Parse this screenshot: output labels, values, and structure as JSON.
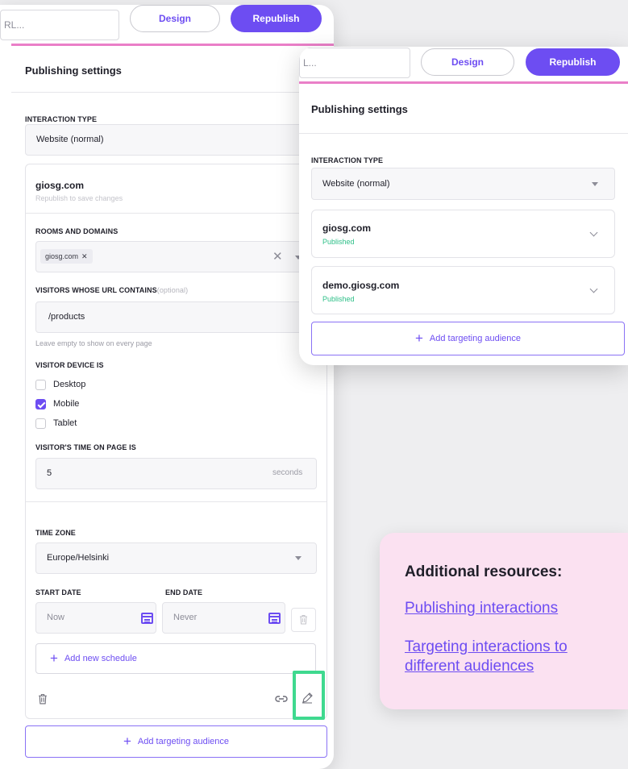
{
  "top_strip": {
    "url_placeholder": "RL...",
    "url_placeholder_right": "L..."
  },
  "toolbar": {
    "design_label": "Design",
    "republish_label": "Republish"
  },
  "left_panel": {
    "title": "Publishing settings",
    "interaction_type_label": "INTERACTION TYPE",
    "interaction_type_value": "Website (normal)",
    "domain": {
      "name": "giosg.com",
      "note": "Republish to save changes"
    },
    "rooms_label": "ROOMS AND DOMAINS",
    "room_chip": "giosg.com",
    "url_contains_label": "VISITORS WHOSE URL CONTAINS",
    "url_contains_optional": "(optional)",
    "url_contains_value": "/products",
    "url_hint": "Leave empty to show on every page",
    "device_label": "VISITOR DEVICE IS",
    "devices": [
      {
        "label": "Desktop",
        "checked": false
      },
      {
        "label": "Mobile",
        "checked": true
      },
      {
        "label": "Tablet",
        "checked": false
      }
    ],
    "time_on_page_label": "VISITOR'S TIME ON PAGE IS",
    "time_on_page_value": "5",
    "time_on_page_unit": "seconds",
    "time_zone_label": "TIME ZONE",
    "time_zone_value": "Europe/Helsinki",
    "start_date_label": "START DATE",
    "start_date_placeholder": "Now",
    "end_date_label": "END DATE",
    "end_date_placeholder": "Never",
    "add_schedule_label": "Add new schedule",
    "add_audience_label": "Add targeting audience"
  },
  "right_panel": {
    "title": "Publishing settings",
    "interaction_type_label": "INTERACTION TYPE",
    "interaction_type_value": "Website (normal)",
    "domains": [
      {
        "name": "giosg.com",
        "status": "Published"
      },
      {
        "name": "demo.giosg.com",
        "status": "Published"
      }
    ],
    "add_audience_label": "Add targeting audience"
  },
  "resources": {
    "title": "Additional resources:",
    "links": [
      "Publishing interactions",
      "Targeting interactions to different audiences"
    ]
  },
  "colors": {
    "accent": "#6d4df2",
    "pink": "#ea7fc8",
    "success": "#2cbf87",
    "highlight": "#3fd98f",
    "resources_bg": "#fbe1f1"
  }
}
